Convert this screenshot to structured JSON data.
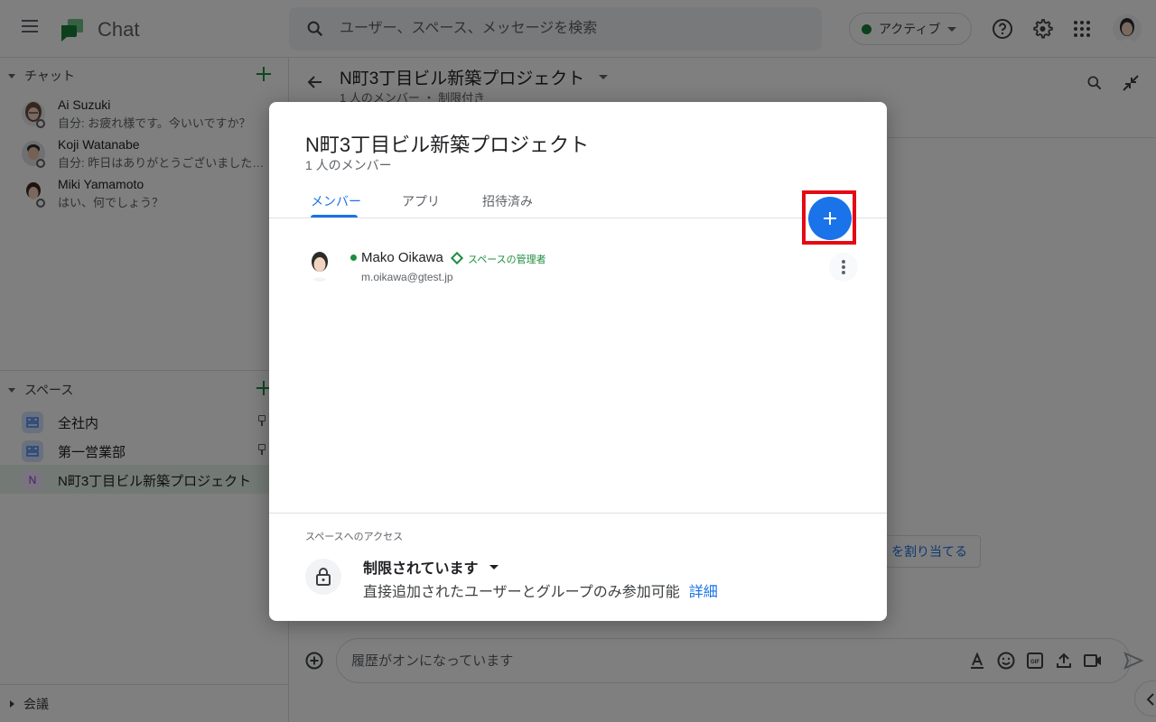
{
  "app": {
    "title": "Chat",
    "search_placeholder": "ユーザー、スペース、メッセージを検索",
    "status": {
      "label": "アクティブ",
      "color": "#188038"
    }
  },
  "sidebar": {
    "chats_header": "チャット",
    "chats": [
      {
        "name": "Ai Suzuki",
        "snippet": "自分: お疲れ様です。今いいですか？"
      },
      {
        "name": "Koji Watanabe",
        "snippet": "自分: 昨日はありがとうございました…"
      },
      {
        "name": "Miki Yamamoto",
        "snippet": "はい、何でしょう？"
      }
    ],
    "spaces_header": "スペース",
    "spaces": [
      {
        "label": "全社内",
        "icon": "space-grid-icon",
        "pinned": true
      },
      {
        "label": "第一営業部",
        "icon": "space-grid-icon",
        "pinned": true
      },
      {
        "label": "N町3丁目ビル新築プロジェクト",
        "icon_letter": "N",
        "selected": true
      }
    ],
    "meetings_header": "会議"
  },
  "main": {
    "space_title": "N町3丁目ビル新築プロジェクト",
    "space_sub": "1 人のメンバー ・ 制限付き",
    "assign_button_partial": "を割り当てる",
    "compose_placeholder": "履歴がオンになっています"
  },
  "dialog": {
    "title": "N町3丁目ビル新築プロジェクト",
    "subtitle": "1 人のメンバー",
    "tabs": [
      {
        "label": "メンバー",
        "active": true
      },
      {
        "label": "アプリ",
        "active": false
      },
      {
        "label": "招待済み",
        "active": false
      }
    ],
    "add_button_highlight_color": "#e50914",
    "members": [
      {
        "name": "Mako Oikawa",
        "role": "スペースの管理者",
        "email": "m.oikawa@gtest.jp",
        "online": true
      }
    ],
    "access": {
      "caption": "スペースへのアクセス",
      "title": "制限されています",
      "description": "直接追加されたユーザーとグループのみ参加可能",
      "link": "詳細"
    }
  },
  "colors": {
    "accent": "#1a73e8",
    "green": "#1e8e3e"
  }
}
